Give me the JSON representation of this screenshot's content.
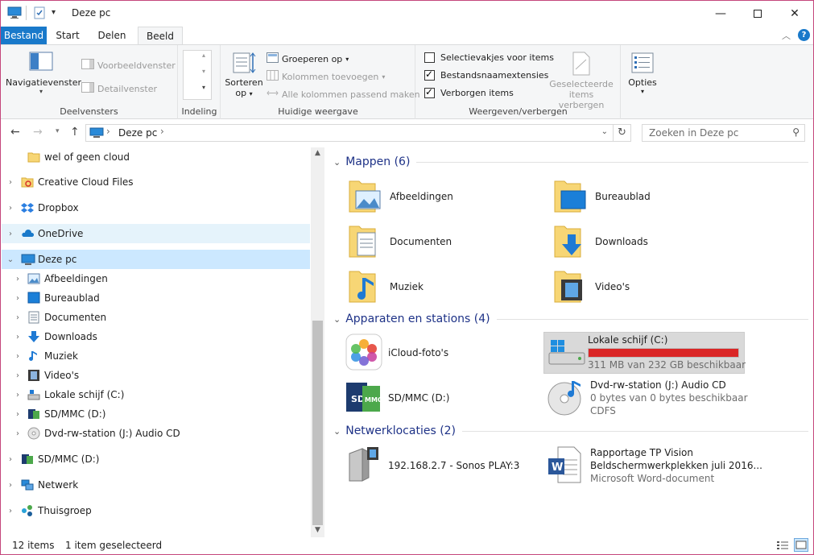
{
  "window": {
    "title": "Deze pc",
    "quick_access_icons": [
      "computer-icon",
      "properties-icon",
      "customize-dropdown-icon"
    ],
    "controls": [
      "minimize-icon",
      "maximize-icon",
      "close-icon"
    ]
  },
  "ribbon_tabs": [
    {
      "label": "Bestand"
    },
    {
      "label": "Start"
    },
    {
      "label": "Delen"
    },
    {
      "label": "Beeld"
    }
  ],
  "ribbon": {
    "deelvensters": {
      "label": "Deelvensters",
      "nav_pane": "Navigatievenster",
      "preview": "Voorbeeldvenster",
      "details": "Detailvenster"
    },
    "indeling": {
      "label": "Indeling"
    },
    "huidige_weergave": {
      "label": "Huidige weergave",
      "sort_line1": "Sorteren",
      "sort_line2": "op",
      "group_by": "Groeperen op",
      "add_columns": "Kolommen toevoegen",
      "fit_columns": "Alle kolommen passend maken"
    },
    "weergeven": {
      "label": "Weergeven/verbergen",
      "checkboxes": [
        {
          "label": "Selectievakjes voor items",
          "checked": false
        },
        {
          "label": "Bestandsnaamextensies",
          "checked": true
        },
        {
          "label": "Verborgen items",
          "checked": true
        }
      ],
      "hide_selected_line1": "Geselecteerde",
      "hide_selected_line2": "items verbergen"
    },
    "options": {
      "label": "Opties"
    }
  },
  "address": {
    "path": "Deze pc",
    "search_placeholder": "Zoeken in Deze pc"
  },
  "nav_items": [
    {
      "label": "wel of geen cloud",
      "icon": "folder-icon"
    },
    {
      "label": "Creative Cloud Files",
      "icon": "creative-cloud-icon"
    },
    {
      "label": "Dropbox",
      "icon": "dropbox-icon"
    },
    {
      "label": "OneDrive",
      "icon": "onedrive-icon"
    },
    {
      "label": "Deze pc",
      "icon": "computer-icon"
    },
    {
      "label": "Afbeeldingen",
      "icon": "pictures-icon"
    },
    {
      "label": "Bureaublad",
      "icon": "desktop-icon"
    },
    {
      "label": "Documenten",
      "icon": "documents-icon"
    },
    {
      "label": "Downloads",
      "icon": "downloads-icon"
    },
    {
      "label": "Muziek",
      "icon": "music-icon"
    },
    {
      "label": "Video's",
      "icon": "videos-icon"
    },
    {
      "label": "Lokale schijf (C:)",
      "icon": "drive-icon"
    },
    {
      "label": "SD/MMC (D:)",
      "icon": "sd-card-icon"
    },
    {
      "label": "Dvd-rw-station (J:) Audio CD",
      "icon": "cd-icon"
    },
    {
      "label": "SD/MMC (D:)",
      "icon": "sd-card-icon"
    },
    {
      "label": "Netwerk",
      "icon": "network-icon"
    },
    {
      "label": "Thuisgroep",
      "icon": "homegroup-icon"
    }
  ],
  "groups": {
    "folders": "Mappen (6)",
    "devices": "Apparaten en stations (4)",
    "network": "Netwerklocaties (2)"
  },
  "folders": [
    {
      "name": "Afbeeldingen",
      "icon": "pictures-folder-icon"
    },
    {
      "name": "Bureaublad",
      "icon": "desktop-folder-icon"
    },
    {
      "name": "Documenten",
      "icon": "documents-folder-icon"
    },
    {
      "name": "Downloads",
      "icon": "downloads-folder-icon"
    },
    {
      "name": "Muziek",
      "icon": "music-folder-icon"
    },
    {
      "name": "Video's",
      "icon": "videos-folder-icon"
    }
  ],
  "devices": [
    {
      "name": "iCloud-foto's",
      "icon": "icloud-photos-icon"
    },
    {
      "name": "Lokale schijf (C:)",
      "sub": "311 MB van 232 GB beschikbaar",
      "used_fraction": 0.9987,
      "bar_color": "#da2626",
      "icon": "windows-drive-icon"
    },
    {
      "name": "SD/MMC (D:)",
      "icon": "sd-card-icon"
    },
    {
      "name": "Dvd-rw-station (J:) Audio CD",
      "sub": "0 bytes van 0 bytes beschikbaar",
      "sub2": "CDFS",
      "icon": "audio-cd-icon"
    }
  ],
  "network": [
    {
      "name": "192.168.2.7 - Sonos PLAY:3",
      "icon": "media-server-icon"
    },
    {
      "name": "Rapportage TP Vision",
      "name2": "Beldschermwerkplekken juli 2016...",
      "sub": "Microsoft Word-document",
      "icon": "word-document-icon"
    }
  ],
  "status": {
    "count": "12 items",
    "selected": "1 item geselecteerd"
  },
  "colors": {
    "accent": "#1979ca",
    "selected": "#cce8ff",
    "hover": "#e5f3fb",
    "group_header": "#1e3287",
    "drive_full": "#da2626"
  }
}
